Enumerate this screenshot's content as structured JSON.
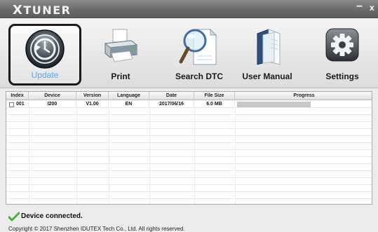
{
  "app": {
    "title_first": "X",
    "title_rest": "TUNER",
    "minimize": "–",
    "close": "x"
  },
  "toolbar": {
    "items": [
      {
        "label": "Update",
        "icon": "update-clock-icon",
        "selected": true
      },
      {
        "label": "Print",
        "icon": "printer-icon"
      },
      {
        "label": "Search DTC",
        "icon": "magnifier-document-icon"
      },
      {
        "label": "User Manual",
        "icon": "manual-book-icon"
      },
      {
        "label": "Settings",
        "icon": "gear-icon"
      }
    ]
  },
  "table": {
    "columns": [
      "Index",
      "Device",
      "Version",
      "Language",
      "Date",
      "File Size",
      "Progress"
    ],
    "rows": [
      {
        "index": "001",
        "device": "I200",
        "version": "V1.00",
        "language": "EN",
        "date": "2017/06/16",
        "file_size": "6.0 MB",
        "progress": 1.0
      }
    ]
  },
  "status": {
    "text": "Device connected.",
    "icon": "green-checkmark-icon",
    "accent": "#4caf3a"
  },
  "footer": {
    "copyright": "Copyright © 2017 Shenzhen IDUTEX Tech Co., Ltd. All rights reserved."
  }
}
